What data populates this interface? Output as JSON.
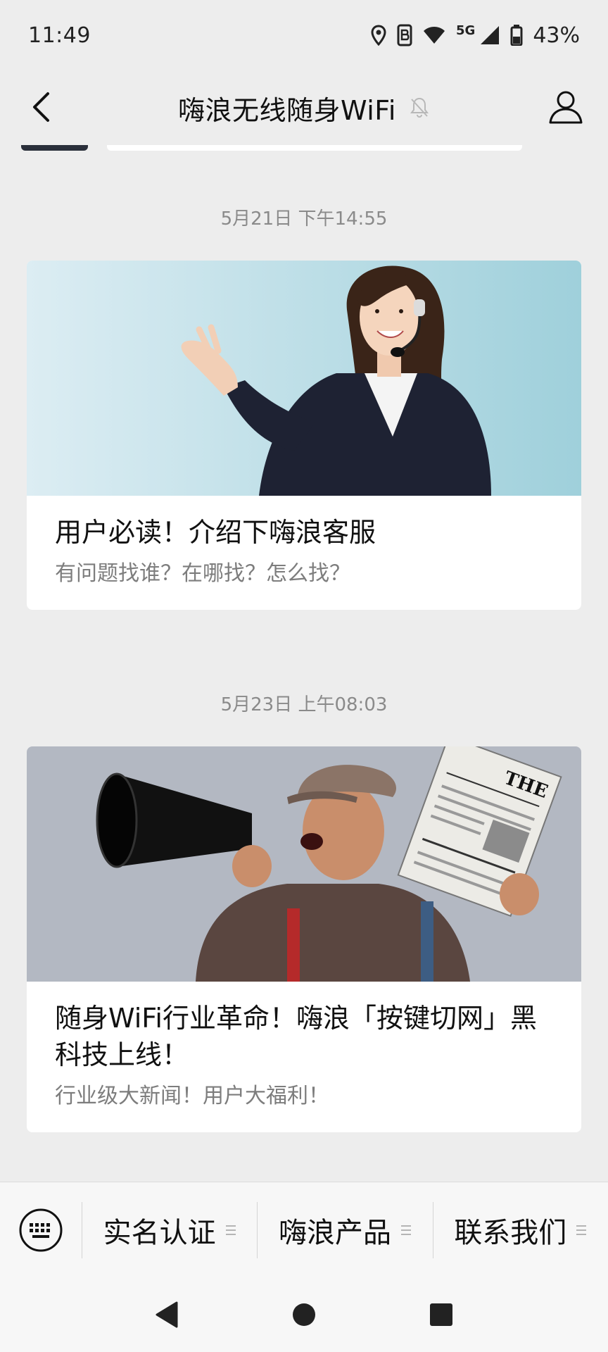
{
  "status_bar": {
    "time": "11:49",
    "network": "5G",
    "battery": "43%"
  },
  "nav": {
    "title": "嗨浪无线随身WiFi"
  },
  "messages": [
    {
      "timestamp": "5月21日 下午14:55",
      "title": "用户必读！介绍下嗨浪客服",
      "description": "有问题找谁？在哪找？怎么找？"
    },
    {
      "timestamp": "5月23日 上午08:03",
      "title": "随身WiFi行业革命！嗨浪「按键切网」黑科技上线！",
      "description": "行业级大新闻！用户大福利！",
      "newspaper_text": "THE"
    }
  ],
  "bottom_menu": {
    "items": [
      {
        "label": "实名认证"
      },
      {
        "label": "嗨浪产品"
      },
      {
        "label": "联系我们"
      }
    ]
  },
  "colors": {
    "background": "#ededed",
    "card": "#ffffff",
    "secondary_text": "#7d7d7d"
  }
}
